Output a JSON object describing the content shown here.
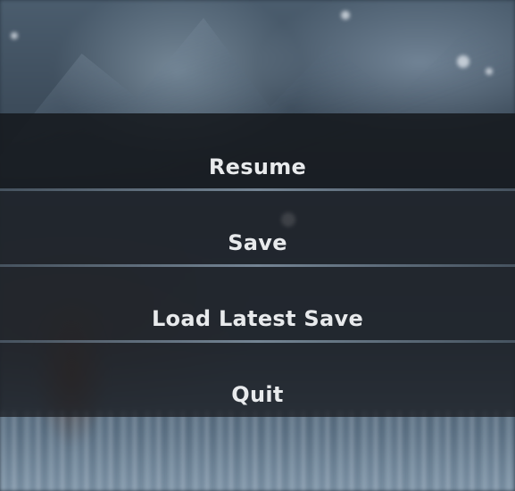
{
  "menu": {
    "items": [
      {
        "label": "Resume"
      },
      {
        "label": "Save"
      },
      {
        "label": "Load Latest Save"
      },
      {
        "label": "Quit"
      }
    ]
  },
  "colors": {
    "panel": "#1c1f24",
    "text": "#e8eaec",
    "separator": "#8294a5"
  }
}
